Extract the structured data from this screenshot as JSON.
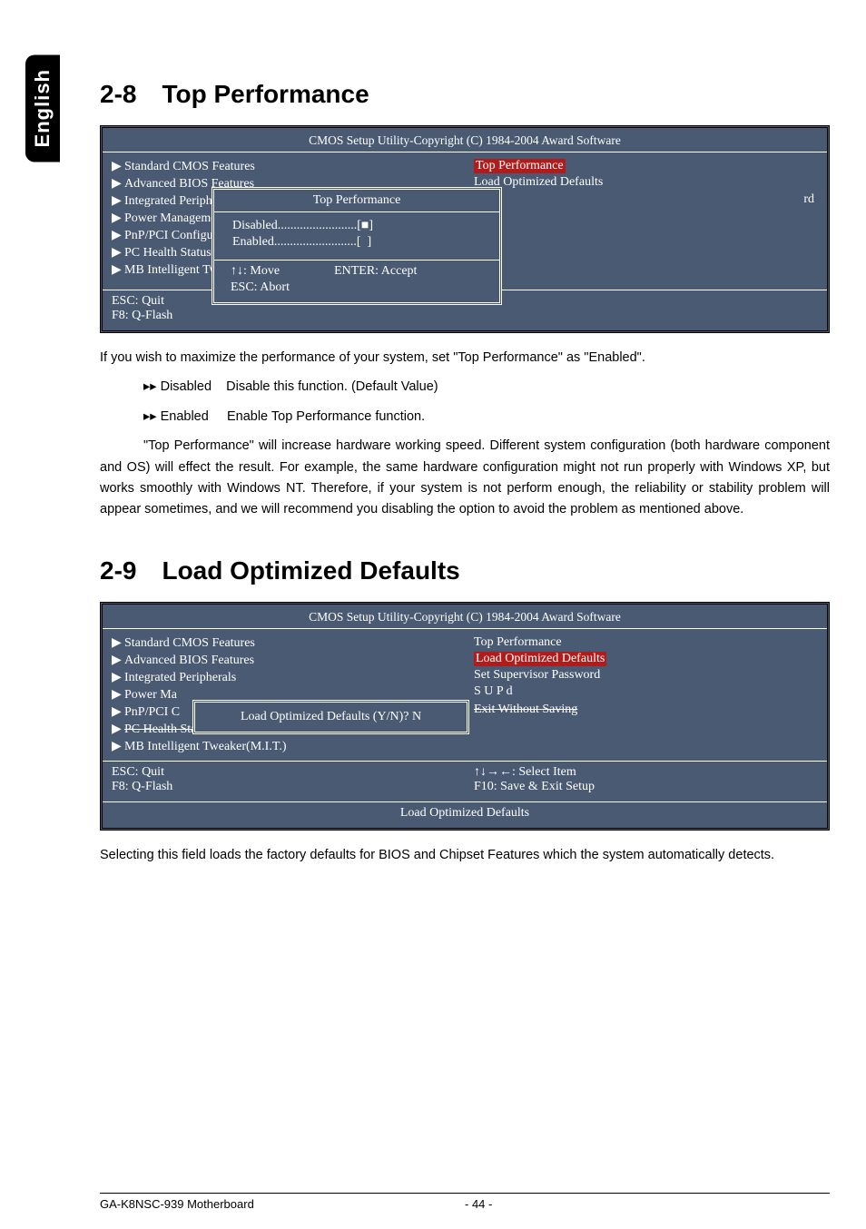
{
  "lang_tab": "English",
  "section_2_8": {
    "num": "2-8",
    "title": "Top Performance"
  },
  "bios1": {
    "header": "CMOS Setup Utility-Copyright (C) 1984-2004 Award Software",
    "left_items": [
      "Standard CMOS Features",
      "Advanced BIOS Features",
      "Integrated Peripheral",
      "Power Management S",
      "PnP/PCI Configuratio",
      "PC Health Status",
      "MB Intelligent Twea"
    ],
    "right_items": [
      "Top Performance",
      "Load Optimized Defaults"
    ],
    "right_frag": "rd",
    "popup_title": "Top Performance",
    "popup_options": [
      "Disabled.........................[■]",
      "Enabled..........................[  ]"
    ],
    "popup_move": "↑↓: Move",
    "popup_accept": "ENTER: Accept",
    "popup_abort": "ESC: Abort",
    "footer_esc": "ESC: Quit",
    "footer_f8": "F8: Q-Flash"
  },
  "text_2_8": {
    "intro": "If you wish to maximize the performance of your system, set \"Top Performance\" as \"Enabled\".",
    "opt_disabled_label": "Disabled",
    "opt_disabled_desc": "Disable this function. (Default Value)",
    "opt_enabled_label": "Enabled",
    "opt_enabled_desc": "Enable Top Performance function.",
    "note": "\"Top Performance\" will increase hardware working speed. Different system configuration (both hardware component and OS) will effect the result. For example, the same hardware configuration might not run properly with Windows XP, but works smoothly with Windows NT.  Therefore, if your system is not perform enough, the reliability or stability problem will appear sometimes, and we will recommend you disabling the option to avoid the problem as mentioned above."
  },
  "section_2_9": {
    "num": "2-9",
    "title": "Load Optimized Defaults"
  },
  "bios2": {
    "header": "CMOS Setup Utility-Copyright (C) 1984-2004 Award Software",
    "left_items": [
      "Standard CMOS Features",
      "Advanced BIOS Features",
      "Integrated Peripherals",
      "Power Ma",
      "PnP/PCI C",
      "PC Health Status",
      "MB Intelligent Tweaker(M.I.T.)"
    ],
    "right_items": [
      "Top Performance",
      "Load Optimized Defaults",
      "Set Supervisor Password",
      "S   U    P          d",
      "",
      "Exit Without Saving"
    ],
    "popup_text": "Load Optimized Defaults (Y/N)? N",
    "footer_esc": "ESC: Quit",
    "footer_select": "↑↓→←: Select Item",
    "footer_f8": "F8: Q-Flash",
    "footer_f10": "F10: Save & Exit Setup",
    "help": "Load Optimized Defaults"
  },
  "text_2_9": "Selecting this field loads the factory defaults for BIOS and Chipset Features which the system automatically detects.",
  "footer": {
    "model": "GA-K8NSC-939 Motherboard",
    "page": "- 44 -"
  }
}
